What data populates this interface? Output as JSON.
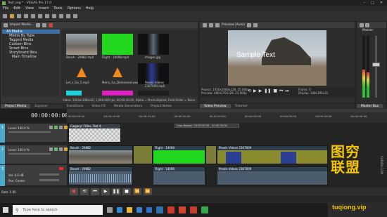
{
  "app": {
    "title": "Test.veg * - VEGAS Pro 17.0"
  },
  "menu": [
    "File",
    "Edit",
    "View",
    "Insert",
    "Tools",
    "Options",
    "Help"
  ],
  "explorer": {
    "header": "Import Media...",
    "tree": [
      "All Media",
      "Media By Type",
      "Tagged Media",
      "Custom Bins",
      "Smart Bins",
      "Storyboard Bins",
      "Main Timeline"
    ]
  },
  "media": [
    {
      "name": "Beach - 29882.mp4"
    },
    {
      "name": "Flight - 14098.mp4"
    },
    {
      "name": "Images.jpg"
    },
    {
      "name": "Let_s_Go_5.mp3"
    },
    {
      "name": "Merry_Go_Distressed.wav"
    },
    {
      "name": "Pexels Videos 2367009.mp4"
    }
  ],
  "media_info": "Video: 1920x1080x32, 1,000.000 fps, 00:00:30:00, Alpha = Premultiplied, Field Order = None",
  "left_tabs": [
    "Project Media",
    "Explorer",
    "Transitions",
    "Video FX",
    "Media Generators",
    "Project Notes"
  ],
  "preview": {
    "header": "Preview (Auto)",
    "overlay": "Sample Text",
    "project": "Project: 1920x1080x128, 25.000p",
    "preview_res": "Preview: 480x270x128, 25.000p",
    "frame_label": "Frame:",
    "frame": "0",
    "display_label": "Display:",
    "display": "348x196x32",
    "tabs": [
      "Video Preview",
      "Trimmer"
    ]
  },
  "master": {
    "label": "Master",
    "tab": "Master Bus"
  },
  "timecode": "00:00:00:00",
  "ruler": [
    "00:00:00:00",
    "00:00:10:00",
    "00:00:15:00",
    "00:00:20:00",
    "00:00:25:00",
    "00:00:30:00",
    "00:00:35:00",
    "00:00:40:00",
    "00:00:45:00"
  ],
  "loop_region": "Loop Region: 00:00:00:00 - 00:00:00:00",
  "tracks": [
    {
      "num": "1",
      "level": "Level: 100.0 %"
    },
    {
      "num": "2",
      "level": "Level: 100.0 %"
    },
    {
      "num": "3",
      "vol": "Vol: 0.0 dB",
      "pan": "Pan: Center"
    }
  ],
  "clips": {
    "text": "(Legacy) Titles, Text 4",
    "v1": "Beach - 29882",
    "v2": "Flight - 14098",
    "v3": "Pexels Videos 2367009",
    "a1": "Beach - 29882",
    "a2": "Flight - 14098",
    "a3": "Pexels Videos 2367009"
  },
  "rate": "Rate: 0.00",
  "taskbar": {
    "search_placeholder": "Type here to search"
  },
  "watermark": {
    "line1": "图穷",
    "line2": "联盟",
    "url": "tuqiong.vip",
    "side": "XURISN.COM"
  }
}
